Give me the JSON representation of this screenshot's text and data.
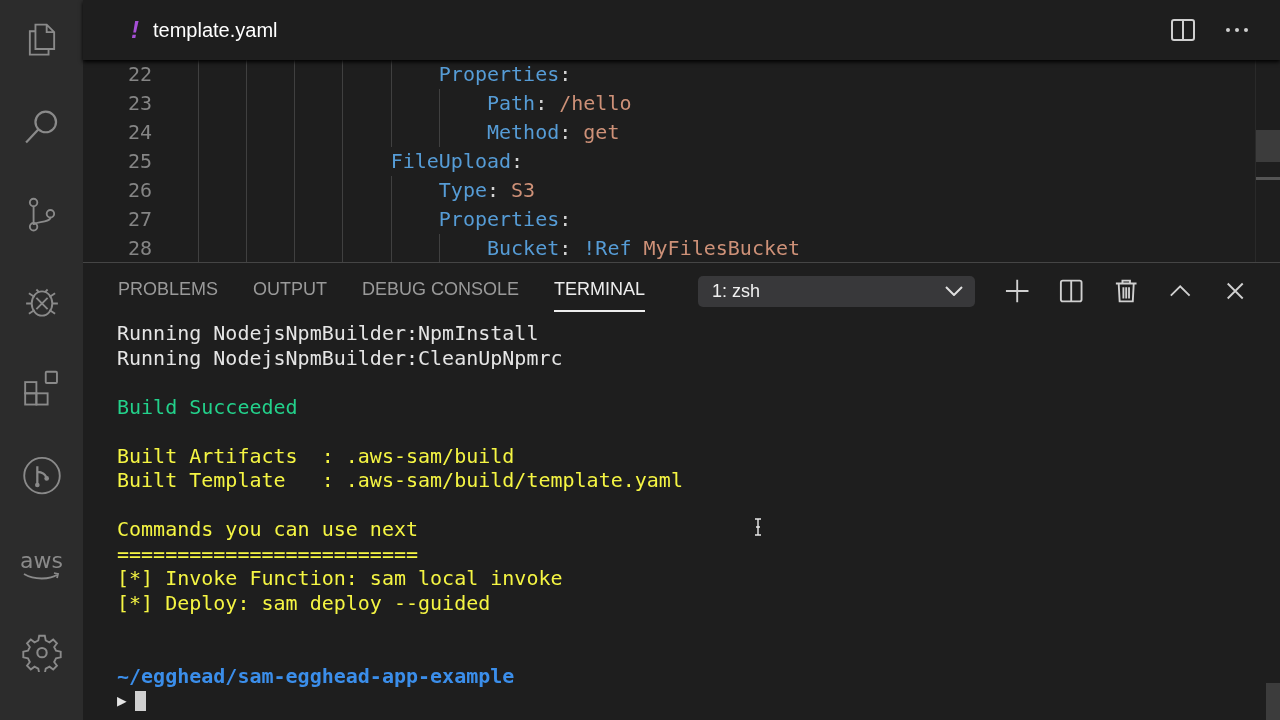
{
  "activity_bar": {
    "logo_text": "aws"
  },
  "editor_tab": {
    "icon": "!",
    "title": "template.yaml"
  },
  "code_lines": [
    {
      "number": "22",
      "parts": [
        {
          "kind": "key",
          "text": "                    Properties"
        },
        {
          "kind": "punct",
          "text": ":"
        }
      ]
    },
    {
      "number": "23",
      "parts": [
        {
          "kind": "key",
          "text": "                        Path"
        },
        {
          "kind": "punct",
          "text": ": "
        },
        {
          "kind": "string",
          "text": "/hello"
        }
      ]
    },
    {
      "number": "24",
      "parts": [
        {
          "kind": "key",
          "text": "                        Method"
        },
        {
          "kind": "punct",
          "text": ": "
        },
        {
          "kind": "string",
          "text": "get"
        }
      ]
    },
    {
      "number": "25",
      "parts": [
        {
          "kind": "key",
          "text": "                FileUpload"
        },
        {
          "kind": "punct",
          "text": ":"
        }
      ]
    },
    {
      "number": "26",
      "parts": [
        {
          "kind": "key",
          "text": "                    Type"
        },
        {
          "kind": "punct",
          "text": ": "
        },
        {
          "kind": "string",
          "text": "S3"
        }
      ]
    },
    {
      "number": "27",
      "parts": [
        {
          "kind": "key",
          "text": "                    Properties"
        },
        {
          "kind": "punct",
          "text": ":"
        }
      ]
    },
    {
      "number": "28",
      "parts": [
        {
          "kind": "key",
          "text": "                        Bucket"
        },
        {
          "kind": "punct",
          "text": ": "
        },
        {
          "kind": "tag",
          "text": "!Ref"
        },
        {
          "kind": "string",
          "text": " MyFilesBucket"
        }
      ]
    }
  ],
  "panel_tabs": [
    {
      "label": "PROBLEMS",
      "selected": false
    },
    {
      "label": "OUTPUT",
      "selected": false
    },
    {
      "label": "DEBUG CONSOLE",
      "selected": false
    },
    {
      "label": "TERMINAL",
      "selected": true
    }
  ],
  "terminal_select": {
    "value": "1: zsh"
  },
  "terminal": {
    "blocks": [
      {
        "lines": [
          {
            "kind": "plain",
            "text": "Running NodejsNpmBuilder:NpmInstall"
          },
          {
            "kind": "plain",
            "text": "Running NodejsNpmBuilder:CleanUpNpmrc"
          }
        ]
      },
      {
        "lines": [
          {
            "kind": "success",
            "text": "Build Succeeded"
          }
        ]
      },
      {
        "lines": [
          {
            "kind": "info",
            "text": "Built Artifacts  : .aws-sam/build"
          },
          {
            "kind": "info",
            "text": "Built Template   : .aws-sam/build/template.yaml"
          }
        ]
      },
      {
        "lines": [
          {
            "kind": "info",
            "text": "Commands you can use next"
          },
          {
            "kind": "info",
            "text": "========================="
          },
          {
            "kind": "info",
            "text": "[*] Invoke Function: sam local invoke"
          },
          {
            "kind": "info",
            "text": "[*] Deploy: sam deploy --guided"
          }
        ]
      }
    ],
    "prompt_path": "~/egghead/sam-egghead-app-example",
    "prompt_symbol": "▶"
  }
}
